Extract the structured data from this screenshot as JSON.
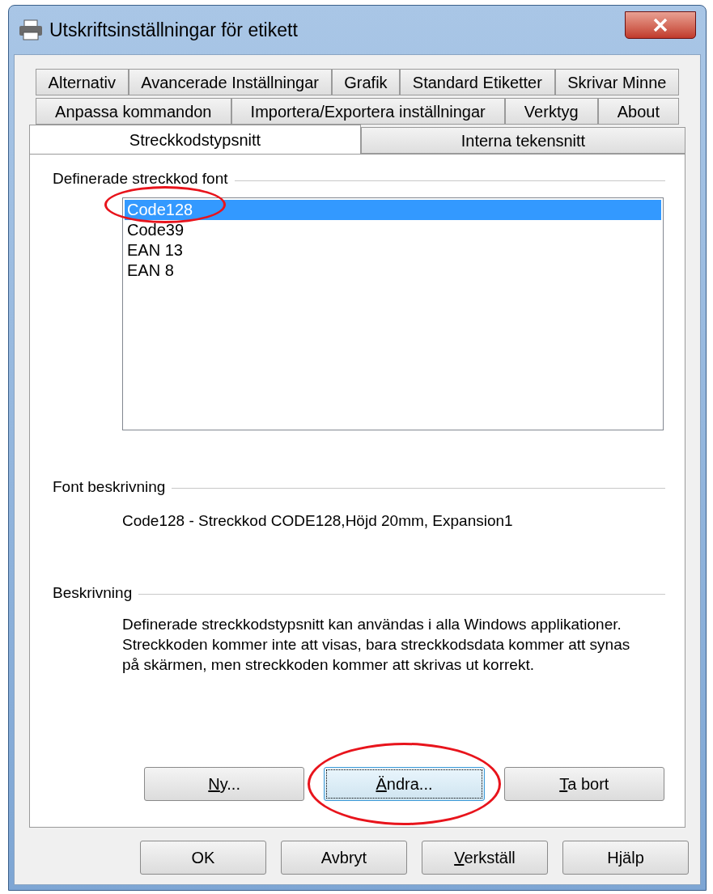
{
  "window": {
    "title": "Utskriftsinställningar för etikett"
  },
  "tab_rows": [
    [
      {
        "label": "Alternativ",
        "selected": false
      },
      {
        "label": "Avancerade Inställningar",
        "selected": false
      },
      {
        "label": "Grafik",
        "selected": false
      },
      {
        "label": "Standard Etiketter",
        "selected": false
      },
      {
        "label": "Skrivar Minne",
        "selected": false
      }
    ],
    [
      {
        "label": "Anpassa kommandon",
        "selected": false
      },
      {
        "label": "Importera/Exportera inställningar",
        "selected": false
      },
      {
        "label": "Verktyg",
        "selected": false
      },
      {
        "label": "About",
        "selected": false
      }
    ],
    [
      {
        "label": "Streckkodstypsnitt",
        "selected": true
      },
      {
        "label": "Interna tekensnitt",
        "selected": false
      }
    ]
  ],
  "defined_fonts": {
    "heading": "Definerade streckkod font",
    "items": [
      {
        "label": "Code128",
        "selected": true,
        "circled": true
      },
      {
        "label": "Code39",
        "selected": false,
        "circled": false
      },
      {
        "label": "EAN 13",
        "selected": false,
        "circled": false
      },
      {
        "label": "EAN 8",
        "selected": false,
        "circled": false
      }
    ]
  },
  "font_description": {
    "heading": "Font beskrivning",
    "text": "Code128 - Streckkod CODE128,Höjd 20mm, Expansion1"
  },
  "description": {
    "heading": "Beskrivning",
    "text": "Definerade streckkodstypsnitt kan användas i alla Windows applikationer. Streckkoden kommer inte att visas, bara streckkodsdata kommer att synas på skärmen, men streckkoden kommer att skrivas ut korrekt."
  },
  "panel_buttons": [
    {
      "mnemonic": "N",
      "rest": "y...",
      "focused": false,
      "circled": false
    },
    {
      "mnemonic": "Ä",
      "rest": "ndra...",
      "focused": true,
      "circled": true
    },
    {
      "mnemonic": "T",
      "rest": "a bort",
      "focused": false,
      "circled": false
    }
  ],
  "dialog_buttons": [
    {
      "rest": "OK"
    },
    {
      "rest": "Avbryt"
    },
    {
      "mnemonic": "V",
      "rest": "erkställ"
    },
    {
      "rest": "Hjälp"
    }
  ]
}
